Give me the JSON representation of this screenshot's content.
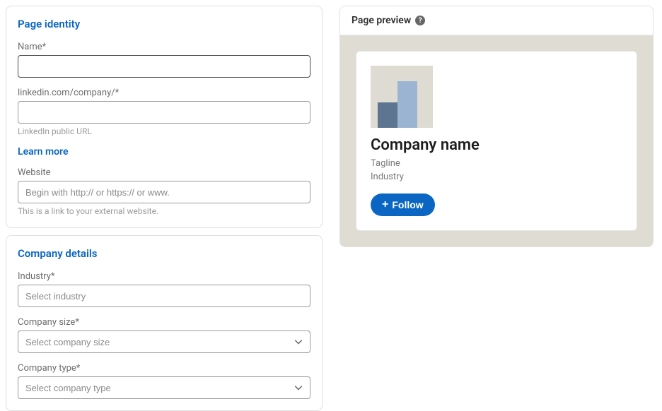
{
  "identity": {
    "section_title": "Page identity",
    "name_label": "Name*",
    "name_value": "",
    "url_label": "linkedin.com/company/*",
    "url_value": "",
    "url_helper": "LinkedIn public URL",
    "learn_more": "Learn more",
    "website_label": "Website",
    "website_placeholder": "Begin with http:// or https:// or www.",
    "website_value": "",
    "website_helper": "This is a link to your external website."
  },
  "details": {
    "section_title": "Company details",
    "industry_label": "Industry*",
    "industry_placeholder": "Select industry",
    "size_label": "Company size*",
    "size_placeholder": "Select company size",
    "type_label": "Company type*",
    "type_placeholder": "Select company type"
  },
  "preview": {
    "header": "Page preview",
    "company_name": "Company name",
    "tagline": "Tagline",
    "industry": "Industry",
    "follow_label": "Follow"
  }
}
